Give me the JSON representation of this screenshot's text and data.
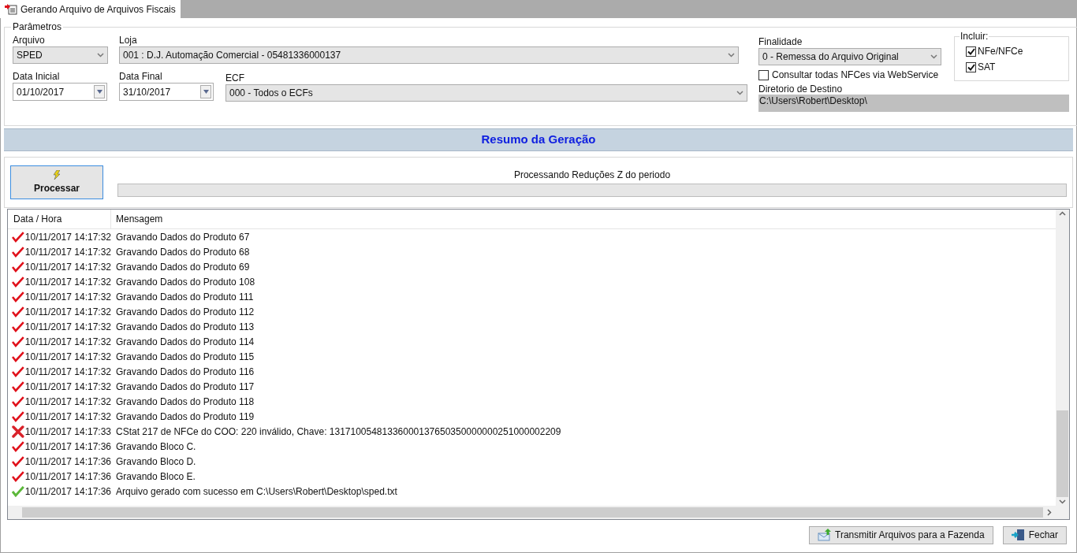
{
  "tab": {
    "title": "Gerando Arquivo de Arquivos Fiscais",
    "selected": true
  },
  "parametros": {
    "legend": "Parâmetros",
    "arquivo": {
      "label": "Arquivo",
      "value": "SPED"
    },
    "loja": {
      "label": "Loja",
      "value": "001 : D.J. Automação Comercial - 05481336000137"
    },
    "finalidade": {
      "label": "Finalidade",
      "value": "0 - Remessa do Arquivo Original"
    },
    "consultar": {
      "label": "Consultar todas NFCes via WebService",
      "checked": false
    },
    "data_inicial": {
      "label": "Data Inicial",
      "value": "01/10/2017"
    },
    "data_final": {
      "label": "Data Final",
      "value": "31/10/2017"
    },
    "ecf": {
      "label": "ECF",
      "value": "000 - Todos o ECFs"
    },
    "diretorio": {
      "label": "Diretorio de Destino",
      "value": "C:\\Users\\Robert\\Desktop\\"
    },
    "incluir": {
      "legend": "Incluir:",
      "items": [
        {
          "label": "NFe/NFCe",
          "checked": true
        },
        {
          "label": "SAT",
          "checked": true
        }
      ]
    }
  },
  "resumo_title": "Resumo da Geração",
  "process_button": "Processar",
  "progress": {
    "label": "Processando Reduções Z do periodo",
    "level": 0
  },
  "log": {
    "columns": [
      "Data / Hora",
      "Mensagem"
    ],
    "rows": [
      {
        "kind": "ok",
        "time": "10/11/2017 14:17:32",
        "message": "Gravando Dados do Produto 67"
      },
      {
        "kind": "ok",
        "time": "10/11/2017 14:17:32",
        "message": "Gravando Dados do Produto 68"
      },
      {
        "kind": "ok",
        "time": "10/11/2017 14:17:32",
        "message": "Gravando Dados do Produto 69"
      },
      {
        "kind": "ok",
        "time": "10/11/2017 14:17:32",
        "message": "Gravando Dados do Produto 108"
      },
      {
        "kind": "ok",
        "time": "10/11/2017 14:17:32",
        "message": "Gravando Dados do Produto 111"
      },
      {
        "kind": "ok",
        "time": "10/11/2017 14:17:32",
        "message": "Gravando Dados do Produto 112"
      },
      {
        "kind": "ok",
        "time": "10/11/2017 14:17:32",
        "message": "Gravando Dados do Produto 113"
      },
      {
        "kind": "ok",
        "time": "10/11/2017 14:17:32",
        "message": "Gravando Dados do Produto 114"
      },
      {
        "kind": "ok",
        "time": "10/11/2017 14:17:32",
        "message": "Gravando Dados do Produto 115"
      },
      {
        "kind": "ok",
        "time": "10/11/2017 14:17:32",
        "message": "Gravando Dados do Produto 116"
      },
      {
        "kind": "ok",
        "time": "10/11/2017 14:17:32",
        "message": "Gravando Dados do Produto 117"
      },
      {
        "kind": "ok",
        "time": "10/11/2017 14:17:32",
        "message": "Gravando Dados do Produto 118"
      },
      {
        "kind": "ok",
        "time": "10/11/2017 14:17:32",
        "message": "Gravando Dados do Produto 119"
      },
      {
        "kind": "error",
        "time": "10/11/2017 14:17:33",
        "message": "CStat 217 de NFCe do COO: 220 inválido, Chave: 13171005481336000137650350000000251000002209"
      },
      {
        "kind": "ok",
        "time": "10/11/2017 14:17:36",
        "message": "Gravando Bloco C."
      },
      {
        "kind": "ok",
        "time": "10/11/2017 14:17:36",
        "message": "Gravando Bloco D."
      },
      {
        "kind": "ok",
        "time": "10/11/2017 14:17:36",
        "message": "Gravando Bloco E."
      },
      {
        "kind": "success",
        "time": "10/11/2017 14:17:36",
        "message": "Arquivo gerado com sucesso em C:\\Users\\Robert\\Desktop\\sped.txt"
      }
    ]
  },
  "buttons": [
    {
      "kind": "transmit",
      "label": "Transmitir Arquivos para a Fazenda"
    },
    {
      "kind": "close",
      "label": "Fechar"
    }
  ]
}
